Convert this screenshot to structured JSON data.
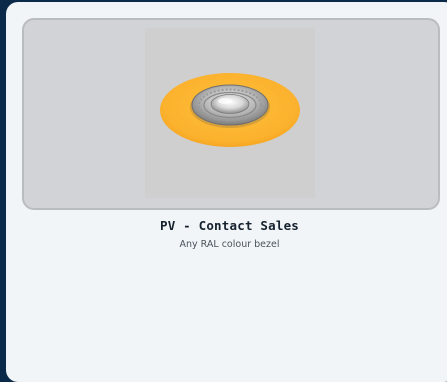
{
  "product": {
    "title": "PV - Contact Sales",
    "subtitle": "Any RAL colour bezel",
    "image": {
      "icon": "downlight-product-image",
      "bezel_color": "#fbb12d",
      "background_color": "#d2d3d6"
    }
  }
}
